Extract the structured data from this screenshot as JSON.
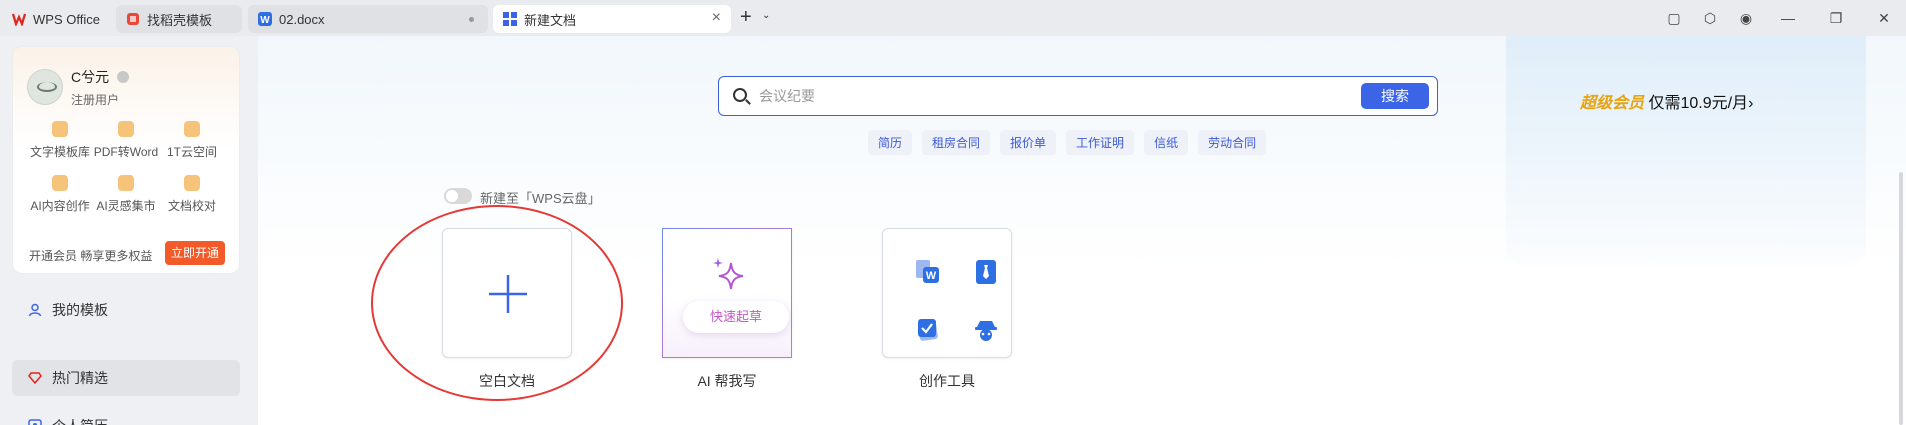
{
  "tabs": [
    {
      "label": "WPS Office"
    },
    {
      "label": "找稻壳模板"
    },
    {
      "label": "02.docx"
    },
    {
      "label": "新建文档"
    }
  ],
  "user": {
    "name": "C兮元",
    "role": "注册用户",
    "features": [
      "文字模板库",
      "PDF转Word",
      "1T云空间",
      "AI内容创作",
      "AI灵感集市",
      "文档校对"
    ],
    "promo_text": "开通会员 畅享更多权益",
    "open_button": "立即开通"
  },
  "nav": [
    {
      "label": "我的模板"
    },
    {
      "label": "热门精选"
    },
    {
      "label": "个人简历"
    }
  ],
  "search": {
    "placeholder": "会议纪要",
    "button": "搜索",
    "tags": [
      "简历",
      "租房合同",
      "报价单",
      "工作证明",
      "信纸",
      "劳动合同"
    ]
  },
  "vip": {
    "label": "超级会员",
    "price": "仅需10.9元/月",
    "arrow": "›"
  },
  "cloud_toggle": {
    "label": "新建至「WPS云盘」",
    "on": false
  },
  "cards": {
    "blank": {
      "label": "空白文档"
    },
    "ai": {
      "label": "AI 帮我写",
      "quick_button": "快速起草"
    },
    "tools": {
      "label": "创作工具"
    }
  },
  "colors": {
    "accent": "#3c64e6",
    "vip": "#e8a310",
    "open_button": "#f25a29",
    "annotation": "#e53935"
  }
}
